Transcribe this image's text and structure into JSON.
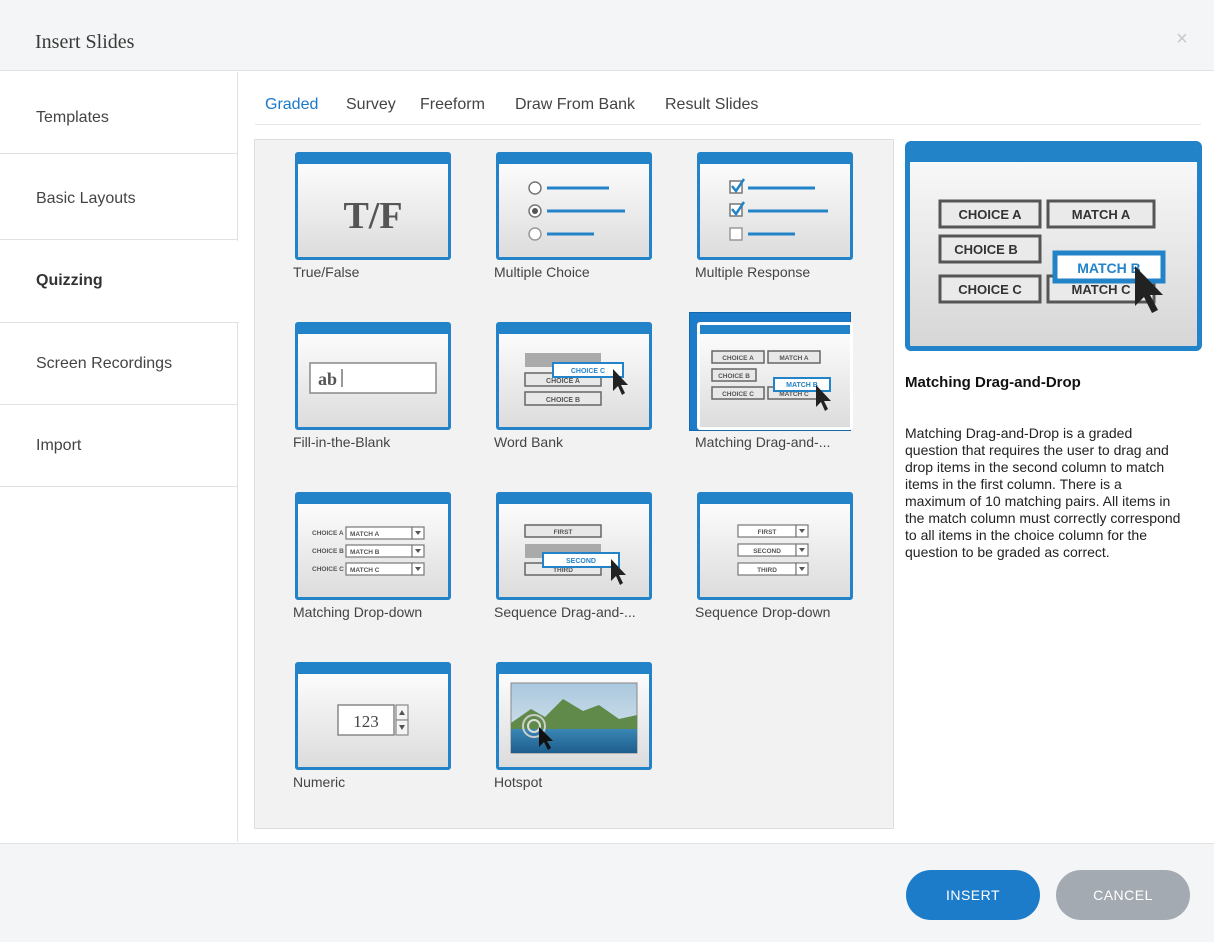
{
  "dialog": {
    "title": "Insert Slides",
    "close_glyph": "×"
  },
  "sidebar": {
    "items": [
      {
        "label": "Templates"
      },
      {
        "label": "Basic Layouts"
      },
      {
        "label": "Quizzing",
        "active": true
      },
      {
        "label": "Screen Recordings"
      },
      {
        "label": "Import"
      }
    ]
  },
  "tabs": [
    {
      "label": "Graded",
      "active": true
    },
    {
      "label": "Survey"
    },
    {
      "label": "Freeform"
    },
    {
      "label": "Draw From Bank"
    },
    {
      "label": "Result Slides"
    }
  ],
  "cards": [
    {
      "label": "True/False",
      "icon": "true-false-icon",
      "thumb_text": "T/F"
    },
    {
      "label": "Multiple Choice",
      "icon": "multiple-choice-icon"
    },
    {
      "label": "Multiple Response",
      "icon": "multiple-response-icon"
    },
    {
      "label": "Fill-in-the-Blank",
      "icon": "fill-in-blank-icon",
      "thumb_text": "ab"
    },
    {
      "label": "Word Bank",
      "icon": "word-bank-icon",
      "thumb_text": [
        "CHOICE C",
        "CHOICE A",
        "CHOICE B"
      ]
    },
    {
      "label": "Matching  Drag-and-...",
      "icon": "matching-drag-drop-icon",
      "selected": true,
      "thumb_text": [
        "CHOICE A",
        "MATCH A",
        "CHOICE B",
        "MATCH B",
        "CHOICE C",
        "MATCH C"
      ]
    },
    {
      "label": "Matching Drop-down",
      "icon": "matching-dropdown-icon",
      "thumb_text": [
        "CHOICE A",
        "MATCH A",
        "CHOICE B",
        "MATCH B",
        "CHOICE C",
        "MATCH C"
      ]
    },
    {
      "label": "Sequence  Drag-and-...",
      "icon": "sequence-drag-drop-icon",
      "thumb_text": [
        "FIRST",
        "SECOND",
        "THIRD"
      ]
    },
    {
      "label": "Sequence Drop-down",
      "icon": "sequence-dropdown-icon",
      "thumb_text": [
        "FIRST",
        "SECOND",
        "THIRD"
      ]
    },
    {
      "label": "Numeric",
      "icon": "numeric-icon",
      "thumb_text": "123"
    },
    {
      "label": "Hotspot",
      "icon": "hotspot-icon"
    }
  ],
  "preview": {
    "title": "Matching Drag-and-Drop",
    "description": "Matching Drag-and-Drop is a graded question that requires the user to drag and drop items in the second column to match items in the first column. There is a maximum of 10 matching pairs. All items in the match column must correctly correspond to all items in the choice column for the question to be graded as correct.",
    "thumb_text": [
      "CHOICE A",
      "MATCH A",
      "CHOICE B",
      "MATCH B",
      "CHOICE C",
      "MATCH C"
    ]
  },
  "footer": {
    "insert_label": "INSERT",
    "cancel_label": "CANCEL"
  },
  "colors": {
    "accent": "#1c7cc9",
    "frame_blue": "#2383c8",
    "cancel_gray": "#a3aab2"
  }
}
